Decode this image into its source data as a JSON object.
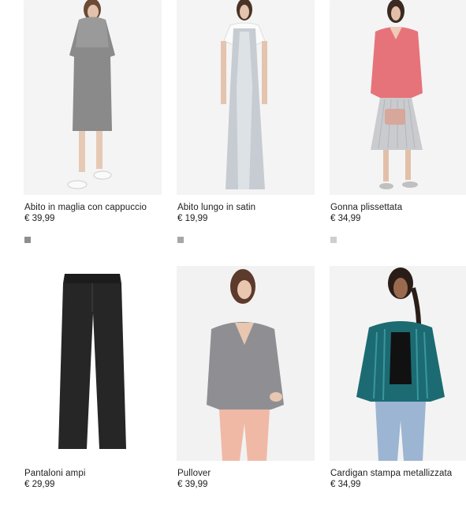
{
  "products": [
    {
      "name": "Abito in maglia con cappuccio",
      "price": "€ 39,99",
      "swatch_color": "#8e8e8e"
    },
    {
      "name": "Abito lungo in satin",
      "price": "€ 19,99",
      "swatch_color": "#a7a7a7"
    },
    {
      "name": "Gonna plissettata",
      "price": "€ 34,99",
      "swatch_color": "#cfcfcf"
    },
    {
      "name": "Pantaloni ampi",
      "price": "€ 29,99"
    },
    {
      "name": "Pullover",
      "price": "€ 39,99"
    },
    {
      "name": "Cardigan stampa metallizzata",
      "price": "€ 34,99"
    }
  ]
}
